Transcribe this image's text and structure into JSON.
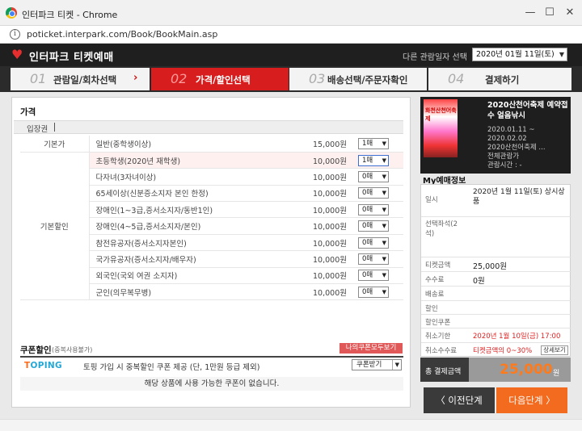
{
  "window": {
    "title": "인터파크 티켓 - Chrome",
    "min": "—",
    "max": "☐",
    "close": "✕"
  },
  "address": {
    "url": "poticket.interpark.com/Book/BookMain.asp",
    "info": "i"
  },
  "header": {
    "brand": "인터파크 티켓예매",
    "other_date_label": "다른 관람일자 선택",
    "date_value": "2020년 01월 11일(토)"
  },
  "steps": [
    {
      "num": "01",
      "label": "관람일/회차선택"
    },
    {
      "num": "02",
      "label": "가격/할인선택"
    },
    {
      "num": "03",
      "label": "배송선택/주문자확인"
    },
    {
      "num": "04",
      "label": "결제하기"
    }
  ],
  "price_section": {
    "title": "가격",
    "tab": "입장권",
    "categories": {
      "base": "기본가",
      "discount": "기본할인"
    },
    "rows": [
      {
        "name": "일반(중학생이상)",
        "price": "15,000원",
        "qty": "1매"
      },
      {
        "name": "초등학생(2020년 재학생)",
        "price": "10,000원",
        "qty": "1매"
      },
      {
        "name": "다자녀(3자녀이상)",
        "price": "10,000원",
        "qty": "0매"
      },
      {
        "name": "65세이상(신분증소지자 본인 한정)",
        "price": "10,000원",
        "qty": "0매"
      },
      {
        "name": "장애인(1~3급,증서소지자/동반1인)",
        "price": "10,000원",
        "qty": "0매"
      },
      {
        "name": "장애인(4~5급,증서소지자/본인)",
        "price": "10,000원",
        "qty": "0매"
      },
      {
        "name": "참전유공자(증서소지자본인)",
        "price": "10,000원",
        "qty": "0매"
      },
      {
        "name": "국가유공자(증서소지자/배우자)",
        "price": "10,000원",
        "qty": "0매"
      },
      {
        "name": "외국인(국외 여권 소지자)",
        "price": "10,000원",
        "qty": "0매"
      },
      {
        "name": "군인(의무복무병)",
        "price": "10,000원",
        "qty": "0매"
      }
    ]
  },
  "coupon": {
    "title": "쿠폰할인",
    "sub": "(중복사용불가)",
    "my_coupon_btn": "나의쿠폰모두보기",
    "logo_t": "T",
    "logo_rest": "OPING",
    "desc": "토핑 가입 시 중복할인 쿠폰 제공 (단, 1만원 등급 제외)",
    "receive": "쿠폰받기",
    "none": "해당 상품에 사용 가능한 쿠폰이 없습니다."
  },
  "show": {
    "poster_text": "화천산천어축제",
    "title": "2020산천어축제 예약접수 얼음낚시",
    "period_start": "2020.01.11 ~",
    "period_end": "2020.02.02",
    "venue": "2020산천어축제 ...",
    "rating": "전체관람가",
    "runtime": "관람시간 : -"
  },
  "my_booking": {
    "title": "My예매정보",
    "date_label": "일시",
    "date_value": "2020년 1월 11일(토) 상시상품",
    "seat_label": "선택좌석(2석)",
    "ticket_label": "티켓금액",
    "ticket_value": "25,000원",
    "fee_label": "수수료",
    "fee_value": "0원",
    "delivery_label": "배송료",
    "discount_label": "할인",
    "coupon_label": "할인쿠폰",
    "cancel_deadline_label": "취소기한",
    "cancel_deadline_value": "2020년 1월 10일(금) 17:00",
    "cancel_fee_label": "취소수수료",
    "cancel_fee_value": "티켓금액의 0~30%",
    "detail_btn": "상세보기"
  },
  "total": {
    "label": "총 결제금액",
    "amount": "25,000",
    "unit": "원"
  },
  "buttons": {
    "prev": "〈  이전단계",
    "next": "다음단계  〉"
  },
  "colors": {
    "accent": "#d71d1d",
    "next": "#f26b1f",
    "brand_heart": "#e62e2e"
  }
}
